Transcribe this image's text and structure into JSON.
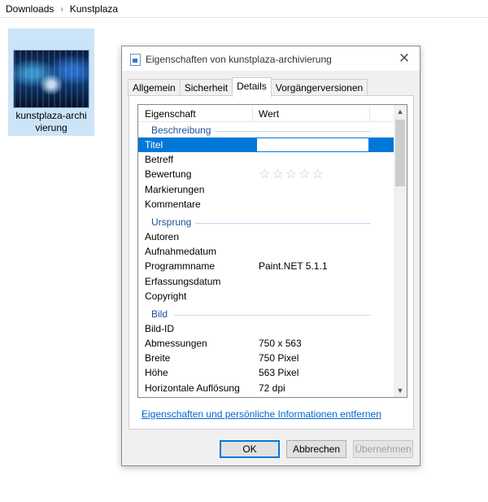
{
  "explorer": {
    "breadcrumb": [
      "Downloads",
      "Kunstplaza"
    ],
    "file": {
      "name_line1": "kunstplaza-archi",
      "name_line2": "vierung"
    }
  },
  "dialog": {
    "title": "Eigenschaften von kunstplaza-archivierung",
    "tabs": [
      {
        "label": "Allgemein",
        "active": false
      },
      {
        "label": "Sicherheit",
        "active": false
      },
      {
        "label": "Details",
        "active": true
      },
      {
        "label": "Vorgängerversionen",
        "active": false
      }
    ],
    "columns": {
      "property": "Eigenschaft",
      "value": "Wert"
    },
    "groups": {
      "description": "Beschreibung",
      "origin": "Ursprung",
      "image": "Bild"
    },
    "properties": {
      "titel": {
        "name": "Titel",
        "value": ""
      },
      "betreff": {
        "name": "Betreff",
        "value": ""
      },
      "bewertung": {
        "name": "Bewertung",
        "stars": "☆☆☆☆☆",
        "rating": 0,
        "max": 5
      },
      "markierungen": {
        "name": "Markierungen",
        "value": ""
      },
      "kommentare": {
        "name": "Kommentare",
        "value": ""
      },
      "autoren": {
        "name": "Autoren",
        "value": ""
      },
      "aufnahmedatum": {
        "name": "Aufnahmedatum",
        "value": ""
      },
      "programmname": {
        "name": "Programmname",
        "value": "Paint.NET 5.1.1"
      },
      "erfassungsdatum": {
        "name": "Erfassungsdatum",
        "value": ""
      },
      "copyright": {
        "name": "Copyright",
        "value": ""
      },
      "bild_id": {
        "name": "Bild-ID",
        "value": ""
      },
      "abmessungen": {
        "name": "Abmessungen",
        "value": "750 x 563"
      },
      "breite": {
        "name": "Breite",
        "value": "750 Pixel"
      },
      "hoehe": {
        "name": "Höhe",
        "value": "563 Pixel"
      },
      "horizontale": {
        "name": "Horizontale Auflösung",
        "value": "72 dpi"
      }
    },
    "remove_link": "Eigenschaften und persönliche Informationen entfernen",
    "buttons": {
      "ok": "OK",
      "cancel": "Abbrechen",
      "apply": "Übernehmen"
    },
    "colors": {
      "selection": "#0078d7",
      "group": "#1e4e9c",
      "link": "#0066cc"
    }
  }
}
